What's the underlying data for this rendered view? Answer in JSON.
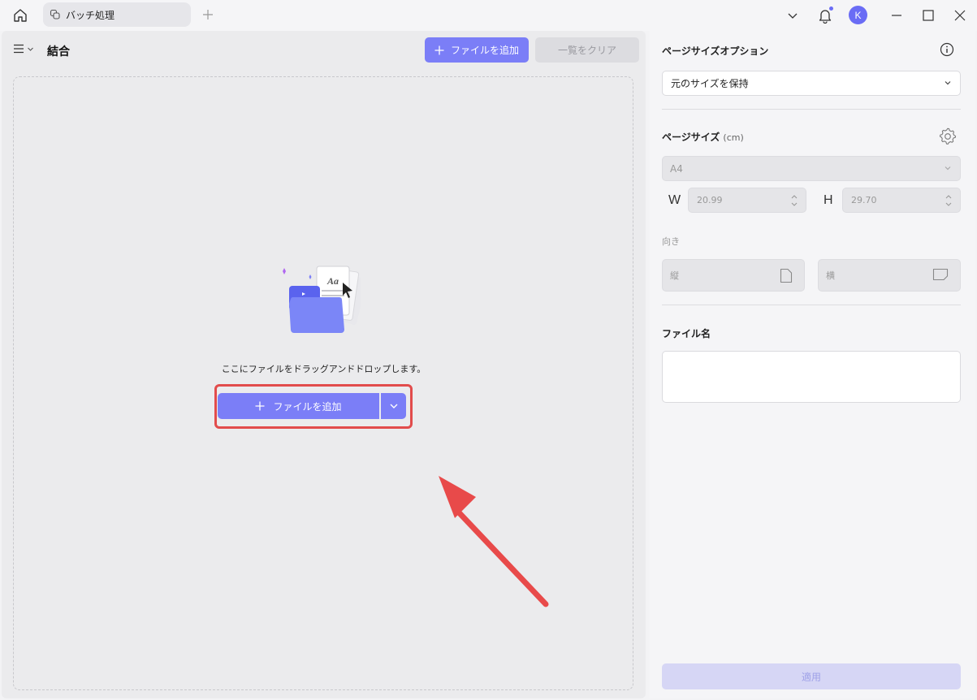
{
  "titlebar": {
    "tab_label": "バッチ処理",
    "avatar_initial": "K"
  },
  "main": {
    "title": "結合",
    "add_file_label": "ファイルを追加",
    "clear_list_label": "一覧をクリア",
    "drop_hint": "ここにファイルをドラッグアンドドロップします。",
    "add_file_main_label": "ファイルを追加",
    "illustration_text": "Aa"
  },
  "side": {
    "page_size_option_title": "ページサイズオプション",
    "page_size_option_value": "元のサイズを保持",
    "page_size_label": "ページサイズ",
    "page_size_unit": "(cm)",
    "paper_value": "A4",
    "width_label": "W",
    "width_value": "20.99",
    "height_label": "H",
    "height_value": "29.70",
    "orientation_label": "向き",
    "portrait_label": "縦",
    "landscape_label": "横",
    "filename_label": "ファイル名",
    "filename_value": "",
    "apply_label": "適用"
  },
  "colors": {
    "accent": "#7b7ef7",
    "highlight": "#e24c4c"
  }
}
